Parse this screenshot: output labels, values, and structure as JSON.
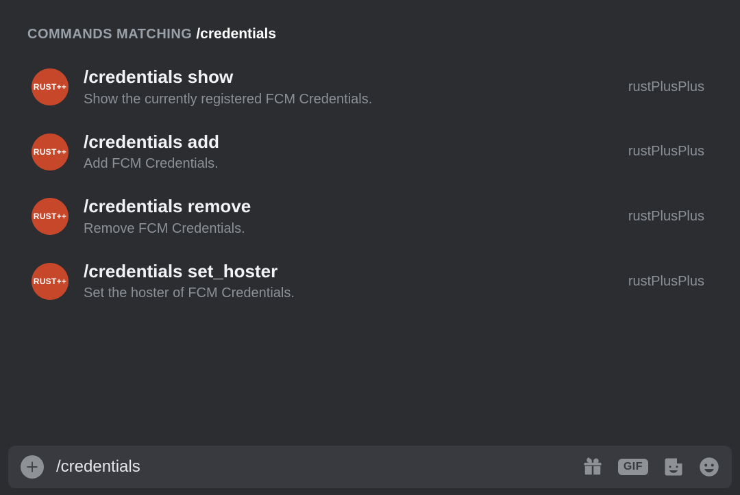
{
  "autocomplete": {
    "header_prefix": "COMMANDS MATCHING",
    "header_query": "/credentials",
    "avatar_label": "RUST++",
    "app_name": "rustPlusPlus",
    "commands": [
      {
        "name": "/credentials show",
        "description": "Show the currently registered FCM Credentials."
      },
      {
        "name": "/credentials add",
        "description": "Add FCM Credentials."
      },
      {
        "name": "/credentials remove",
        "description": "Remove FCM Credentials."
      },
      {
        "name": "/credentials set_hoster",
        "description": "Set the hoster of FCM Credentials."
      }
    ]
  },
  "input": {
    "value": "/credentials",
    "gif_label": "GIF"
  }
}
